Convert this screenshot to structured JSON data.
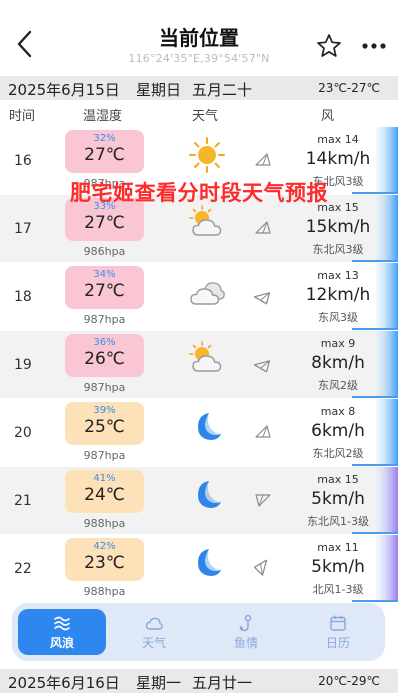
{
  "header": {
    "title": "当前位置",
    "coords": "116°24'35\"E,39°54'57\"N"
  },
  "day1": {
    "date": "2025年6月15日",
    "weekday": "星期日",
    "lunar": "五月二十",
    "temp_range": "23℃-27℃"
  },
  "columns": {
    "time": "时间",
    "temp_humidity": "温湿度",
    "weather": "天气",
    "wind": "风"
  },
  "watermark": "肥宅姬查看分时段天气预报",
  "rows": [
    {
      "hour": "16",
      "humidity": "32%",
      "temp": "27℃",
      "pressure": "987hpa",
      "weather_icon": "sunny-icon",
      "wind_dir": "northeast",
      "max": "max 14",
      "speed": "14km/h",
      "level": "东北风3级",
      "pill": "pink"
    },
    {
      "hour": "17",
      "humidity": "33%",
      "temp": "27℃",
      "pressure": "986hpa",
      "weather_icon": "partly-cloudy-icon",
      "wind_dir": "northeast",
      "max": "max 15",
      "speed": "15km/h",
      "level": "东北风3级",
      "pill": "pink"
    },
    {
      "hour": "18",
      "humidity": "34%",
      "temp": "27℃",
      "pressure": "987hpa",
      "weather_icon": "cloudy-icon",
      "wind_dir": "east",
      "max": "max 13",
      "speed": "12km/h",
      "level": "东风3级",
      "pill": "pink"
    },
    {
      "hour": "19",
      "humidity": "36%",
      "temp": "26℃",
      "pressure": "987hpa",
      "weather_icon": "partly-cloudy-icon",
      "wind_dir": "east",
      "max": "max 9",
      "speed": "8km/h",
      "level": "东风2级",
      "pill": "pink"
    },
    {
      "hour": "20",
      "humidity": "39%",
      "temp": "25℃",
      "pressure": "987hpa",
      "weather_icon": "moon-icon",
      "wind_dir": "northeast",
      "max": "max 8",
      "speed": "6km/h",
      "level": "东北风2级",
      "pill": "peach"
    },
    {
      "hour": "21",
      "humidity": "41%",
      "temp": "24℃",
      "pressure": "988hpa",
      "weather_icon": "moon-icon",
      "wind_dir": "southwest",
      "max": "max 15",
      "speed": "5km/h",
      "level": "东北风1-3级",
      "pill": "peach"
    },
    {
      "hour": "22",
      "humidity": "42%",
      "temp": "23℃",
      "pressure": "988hpa",
      "weather_icon": "moon-icon",
      "wind_dir": "south",
      "max": "max 11",
      "speed": "5km/h",
      "level": "北风1-3级",
      "pill": "peach"
    }
  ],
  "tabs": [
    {
      "label": "风浪",
      "icon": "wind-wave-icon",
      "active": true
    },
    {
      "label": "天气",
      "icon": "cloud-icon",
      "active": false
    },
    {
      "label": "鱼情",
      "icon": "fish-hook-icon",
      "active": false
    },
    {
      "label": "日历",
      "icon": "calendar-icon",
      "active": false
    }
  ],
  "day2": {
    "date": "2025年6月16日",
    "weekday": "星期一",
    "lunar": "五月廿一",
    "temp_range": "20℃-29℃"
  },
  "colors": {
    "accent": "#2e87ef",
    "pill_pink": "#fbc6d4",
    "pill_peach": "#fde1b8",
    "watermark": "#ff2a2a",
    "humidity": "#3a8ee8"
  }
}
